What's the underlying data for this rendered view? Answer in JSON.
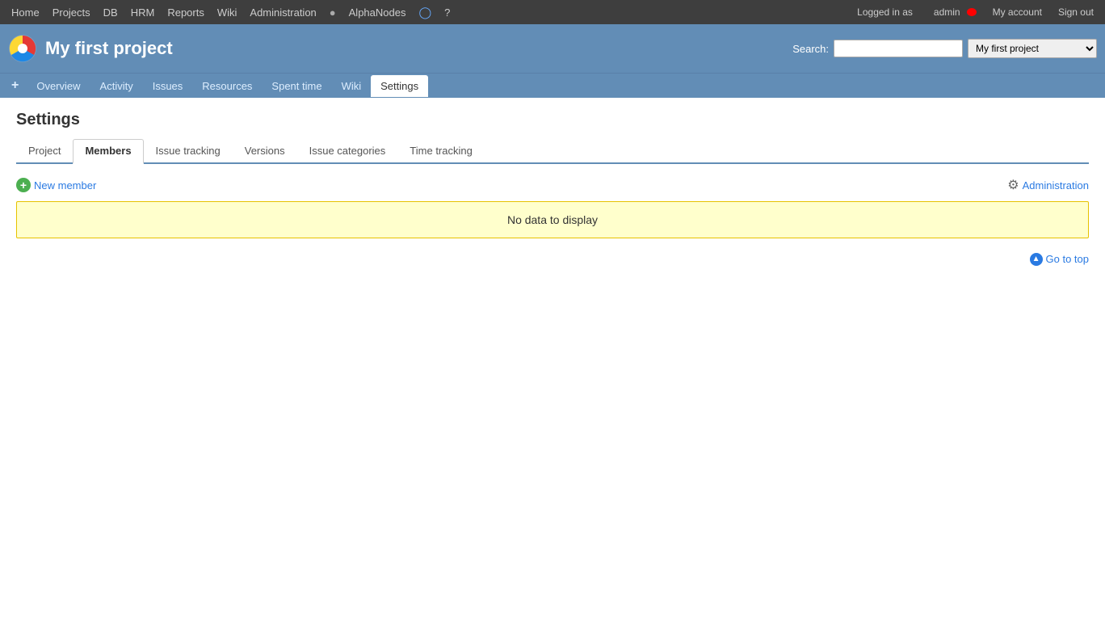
{
  "topnav": {
    "items": [
      {
        "label": "Home",
        "id": "home"
      },
      {
        "label": "Projects",
        "id": "projects"
      },
      {
        "label": "DB",
        "id": "db"
      },
      {
        "label": "HRM",
        "id": "hrm"
      },
      {
        "label": "Reports",
        "id": "reports"
      },
      {
        "label": "Wiki",
        "id": "wiki"
      },
      {
        "label": "Administration",
        "id": "administration"
      }
    ],
    "alphanodes_label": "AlphaNodes",
    "help_label": "?",
    "logged_in_as": "Logged in as",
    "user": "admin",
    "my_account": "My account",
    "sign_out": "Sign out"
  },
  "project": {
    "title": "My first project",
    "search_label": "Search:",
    "search_placeholder": "",
    "search_scope": "My first project"
  },
  "project_nav": {
    "plus": "+",
    "items": [
      {
        "label": "Overview",
        "id": "overview",
        "active": false
      },
      {
        "label": "Activity",
        "id": "activity",
        "active": false
      },
      {
        "label": "Issues",
        "id": "issues",
        "active": false
      },
      {
        "label": "Resources",
        "id": "resources",
        "active": false
      },
      {
        "label": "Spent time",
        "id": "spent-time",
        "active": false
      },
      {
        "label": "Wiki",
        "id": "wiki",
        "active": false
      },
      {
        "label": "Settings",
        "id": "settings",
        "active": true
      }
    ]
  },
  "settings": {
    "page_title": "Settings",
    "tabs": [
      {
        "label": "Project",
        "id": "project",
        "active": false
      },
      {
        "label": "Members",
        "id": "members",
        "active": true
      },
      {
        "label": "Issue tracking",
        "id": "issue-tracking",
        "active": false
      },
      {
        "label": "Versions",
        "id": "versions",
        "active": false
      },
      {
        "label": "Issue categories",
        "id": "issue-categories",
        "active": false
      },
      {
        "label": "Time tracking",
        "id": "time-tracking",
        "active": false
      }
    ],
    "new_member_label": "New member",
    "administration_label": "Administration",
    "no_data_label": "No data to display",
    "go_to_top_label": "Go to top"
  }
}
